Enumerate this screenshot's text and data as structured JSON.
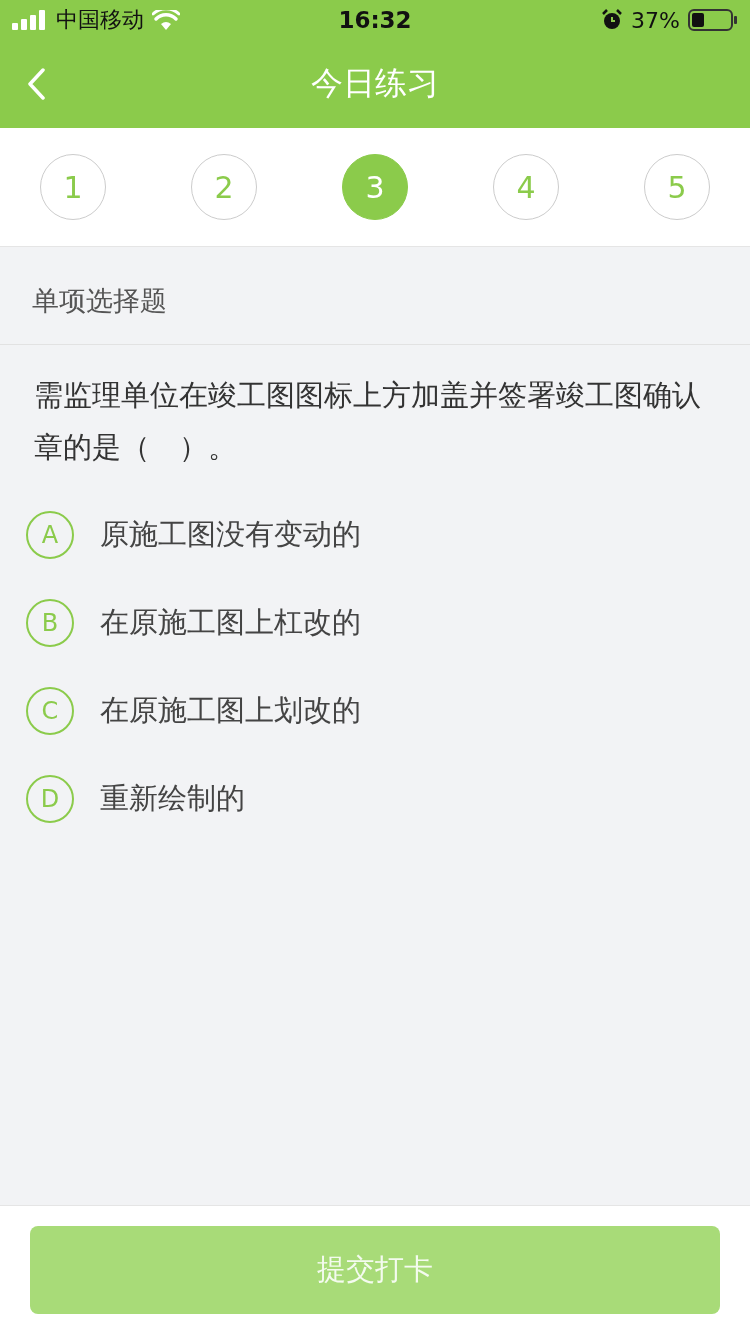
{
  "status_bar": {
    "carrier": "中国移动",
    "time": "16:32",
    "battery": "37%"
  },
  "header": {
    "title": "今日练习"
  },
  "steps": [
    {
      "label": "1",
      "selected": false
    },
    {
      "label": "2",
      "selected": false
    },
    {
      "label": "3",
      "selected": true
    },
    {
      "label": "4",
      "selected": false
    },
    {
      "label": "5",
      "selected": false
    }
  ],
  "section_title": "单项选择题",
  "question": "需监理单位在竣工图图标上方加盖并签署竣工图确认章的是（　）。",
  "options": [
    {
      "letter": "A",
      "text": "原施工图没有变动的",
      "selected": false
    },
    {
      "letter": "B",
      "text": "在原施工图上杠改的",
      "selected": false
    },
    {
      "letter": "C",
      "text": "在原施工图上划改的",
      "selected": false
    },
    {
      "letter": "D",
      "text": "重新绘制的",
      "selected": false
    }
  ],
  "submit": {
    "label": "提交打卡",
    "disabled": true
  }
}
